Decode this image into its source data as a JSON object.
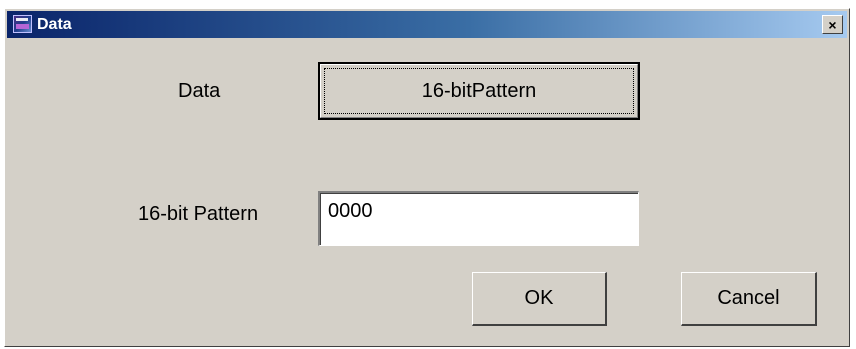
{
  "window": {
    "title": "Data",
    "close_label": "×"
  },
  "form": {
    "data_label": "Data",
    "data_button_label": "16-bitPattern",
    "pattern_label": "16-bit Pattern",
    "pattern_value": "0000"
  },
  "buttons": {
    "ok_label": "OK",
    "cancel_label": "Cancel"
  },
  "colors": {
    "titlebar_start": "#0a246a",
    "titlebar_end": "#a6caf0",
    "dialog_face": "#d4d0c8"
  },
  "icons": {
    "app": "app-icon",
    "close": "close-icon"
  }
}
